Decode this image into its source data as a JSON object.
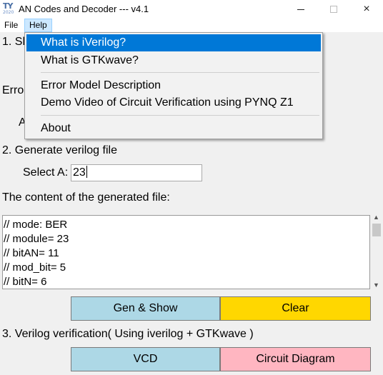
{
  "window": {
    "title": "AN Codes and Decoder --- v4.1",
    "icon_text": "TY",
    "icon_subtext": "2020",
    "controls": {
      "minimize": "minimize-icon",
      "maximize": "maximize-icon",
      "close": "×"
    }
  },
  "menubar": {
    "items": [
      {
        "label": "File"
      },
      {
        "label": "Help"
      }
    ]
  },
  "help_menu": {
    "items": [
      {
        "label": "What is iVerilog?"
      },
      {
        "label": "What is GTKwave?"
      },
      {
        "label": "Error Model Description"
      },
      {
        "label": "Demo Video of Circuit Verification using PYNQ Z1"
      },
      {
        "label": "About"
      }
    ]
  },
  "section1": {
    "title_partial": "1. Sh",
    "error_label_partial": "Erro",
    "a_label_partial": "A"
  },
  "section2": {
    "title": "2. Generate verilog file",
    "select_a_label": "Select A:",
    "select_a_value": "23",
    "content_label": "The content of the generated file:",
    "file_lines": [
      "// mode: BER",
      "// module= 23",
      "// bitAN= 11",
      "// mod_bit= 5",
      "// bitN= 6"
    ],
    "gen_show_label": "Gen & Show",
    "clear_label": "Clear"
  },
  "section3": {
    "title": "3. Verilog verification( Using iverilog + GTKwave )",
    "vcd_label": "VCD",
    "circuit_label": "Circuit Diagram"
  },
  "colors": {
    "gen_button": "#add8e6",
    "clear_button": "#ffd700",
    "vcd_button": "#add8e6",
    "circuit_button": "#ffb6c1",
    "menu_highlight": "#0078d7"
  }
}
